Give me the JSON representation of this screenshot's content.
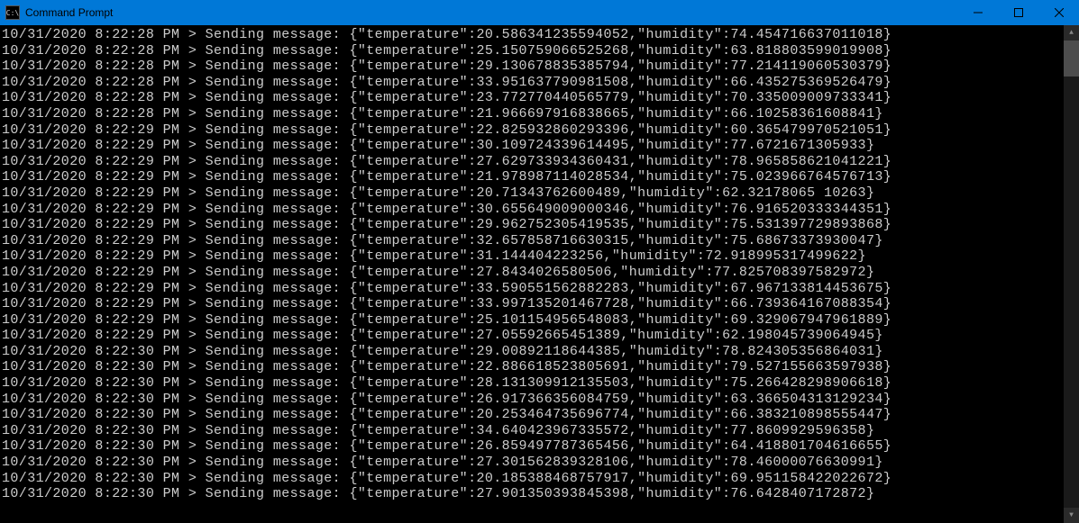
{
  "window": {
    "title": "Command Prompt",
    "icon_label": "C:\\"
  },
  "lines": [
    {
      "ts": "10/31/2020 8:22:28 PM",
      "prefix": "> Sending message:",
      "temp": "20.586341235594052",
      "hum": "74.454716637011018"
    },
    {
      "ts": "10/31/2020 8:22:28 PM",
      "prefix": "> Sending message:",
      "temp": "25.150759066525268",
      "hum": "63.818803599019908"
    },
    {
      "ts": "10/31/2020 8:22:28 PM",
      "prefix": "> Sending message:",
      "temp": "29.130678835385794",
      "hum": "77.214119060530379"
    },
    {
      "ts": "10/31/2020 8:22:28 PM",
      "prefix": "> Sending message:",
      "temp": "33.951637790981508",
      "hum": "66.435275369526479"
    },
    {
      "ts": "10/31/2020 8:22:28 PM",
      "prefix": "> Sending message:",
      "temp": "23.772770440565779",
      "hum": "70.335009009733341"
    },
    {
      "ts": "10/31/2020 8:22:28 PM",
      "prefix": "> Sending message:",
      "temp": "21.966697916838665",
      "hum": "66.10258361608841"
    },
    {
      "ts": "10/31/2020 8:22:29 PM",
      "prefix": "> Sending message:",
      "temp": "22.825932860293396",
      "hum": "60.365479970521051"
    },
    {
      "ts": "10/31/2020 8:22:29 PM",
      "prefix": "> Sending message:",
      "temp": "30.109724339614495",
      "hum": "77.6721671305933"
    },
    {
      "ts": "10/31/2020 8:22:29 PM",
      "prefix": "> Sending message:",
      "temp": "27.629733934360431",
      "hum": "78.965858621041221"
    },
    {
      "ts": "10/31/2020 8:22:29 PM",
      "prefix": "> Sending message:",
      "temp": "21.978987114028534",
      "hum": "75.023966764576713"
    },
    {
      "ts": "10/31/2020 8:22:29 PM",
      "prefix": "> Sending message:",
      "temp": "20.71343762600489",
      "hum": "62.32178065 10263"
    },
    {
      "ts": "10/31/2020 8:22:29 PM",
      "prefix": "> Sending message:",
      "temp": "30.655649009000346",
      "hum": "76.916520333344351"
    },
    {
      "ts": "10/31/2020 8:22:29 PM",
      "prefix": "> Sending message:",
      "temp": "29.962752305419535",
      "hum": "75.531397729893868"
    },
    {
      "ts": "10/31/2020 8:22:29 PM",
      "prefix": "> Sending message:",
      "temp": "32.657858716630315",
      "hum": "75.68673373930047"
    },
    {
      "ts": "10/31/2020 8:22:29 PM",
      "prefix": "> Sending message:",
      "temp": "31.144404223256",
      "hum": "72.918995317499622"
    },
    {
      "ts": "10/31/2020 8:22:29 PM",
      "prefix": "> Sending message:",
      "temp": "27.8434026580506",
      "hum": "77.825708397582972"
    },
    {
      "ts": "10/31/2020 8:22:29 PM",
      "prefix": "> Sending message:",
      "temp": "33.590551562882283",
      "hum": "67.967133814453675"
    },
    {
      "ts": "10/31/2020 8:22:29 PM",
      "prefix": "> Sending message:",
      "temp": "33.997135201467728",
      "hum": "66.739364167088354"
    },
    {
      "ts": "10/31/2020 8:22:29 PM",
      "prefix": "> Sending message:",
      "temp": "25.101154956548083",
      "hum": "69.329067947961889"
    },
    {
      "ts": "10/31/2020 8:22:29 PM",
      "prefix": "> Sending message:",
      "temp": "27.05592665451389",
      "hum": "62.198045739064945"
    },
    {
      "ts": "10/31/2020 8:22:30 PM",
      "prefix": "> Sending message:",
      "temp": "29.00892118644385",
      "hum": "78.824305356864031"
    },
    {
      "ts": "10/31/2020 8:22:30 PM",
      "prefix": "> Sending message:",
      "temp": "22.886618523805691",
      "hum": "79.527155663597938"
    },
    {
      "ts": "10/31/2020 8:22:30 PM",
      "prefix": "> Sending message:",
      "temp": "28.131309912135503",
      "hum": "75.266428298906618"
    },
    {
      "ts": "10/31/2020 8:22:30 PM",
      "prefix": "> Sending message:",
      "temp": "26.917366356084759",
      "hum": "63.366504313129234"
    },
    {
      "ts": "10/31/2020 8:22:30 PM",
      "prefix": "> Sending message:",
      "temp": "20.253464735696774",
      "hum": "66.383210898555447"
    },
    {
      "ts": "10/31/2020 8:22:30 PM",
      "prefix": "> Sending message:",
      "temp": "34.640423967335572",
      "hum": "77.8609929596358"
    },
    {
      "ts": "10/31/2020 8:22:30 PM",
      "prefix": "> Sending message:",
      "temp": "26.859497787365456",
      "hum": "64.418801704616655"
    },
    {
      "ts": "10/31/2020 8:22:30 PM",
      "prefix": "> Sending message:",
      "temp": "27.301562839328106",
      "hum": "78.46000076630991"
    },
    {
      "ts": "10/31/2020 8:22:30 PM",
      "prefix": "> Sending message:",
      "temp": "20.185388468757917",
      "hum": "69.951158422022672"
    },
    {
      "ts": "10/31/2020 8:22:30 PM",
      "prefix": "> Sending message:",
      "temp": "27.901350393845398",
      "hum": "76.6428407172872"
    }
  ]
}
